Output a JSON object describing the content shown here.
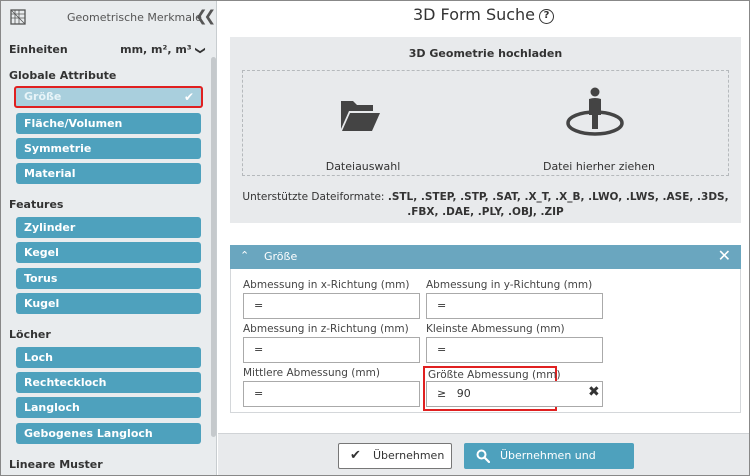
{
  "sidebar": {
    "title": "Geometrische Merkmale",
    "collapse_icon": "double-chevron-left-icon",
    "units": {
      "label": "Einheiten",
      "value": "mm, m², m³"
    },
    "sections": {
      "global": "Globale Attribute",
      "features": "Features",
      "holes": "Löcher",
      "patterns": "Lineare Muster"
    },
    "global_items": [
      "Größe",
      "Fläche/Volumen",
      "Symmetrie",
      "Material"
    ],
    "feature_items": [
      "Zylinder",
      "Kegel",
      "Torus",
      "Kugel"
    ],
    "hole_items": [
      "Loch",
      "Rechteckloch",
      "Langloch",
      "Gebogenes Langloch"
    ]
  },
  "main": {
    "title": "3D Form Suche",
    "help_icon": "?",
    "upload": {
      "title": "3D Geometrie hochladen",
      "file_select_label": "Dateiauswahl",
      "drag_label": "Datei hierher ziehen",
      "formats_prefix": "Unterstützte Dateiformate:",
      "formats": ".STL, .STEP, .STP, .SAT, .X_T, .X_B, .LWO, .LWS, .ASE, .3DS, .FBX, .DAE, .PLY, .OBJ, .ZIP"
    },
    "size_panel": {
      "title": "Größe",
      "fields": [
        {
          "label": "Abmessung in x-Richtung (mm)",
          "value": "="
        },
        {
          "label": "Abmessung in y-Richtung (mm)",
          "value": "="
        },
        {
          "label": "Abmessung in z-Richtung (mm)",
          "value": "="
        },
        {
          "label": "Kleinste Abmessung (mm)",
          "value": "="
        },
        {
          "label": "Mittlere Abmessung (mm)",
          "value": "="
        },
        {
          "label": "Größte Abmessung (mm)",
          "value": "≥   90"
        }
      ]
    },
    "footer": {
      "apply_label": "Übernehmen",
      "apply_search_label": "Übernehmen und suchen"
    }
  },
  "colors": {
    "accent": "#4ea1bd",
    "panel_header": "#6aa6bf",
    "highlight": "#e02020"
  }
}
